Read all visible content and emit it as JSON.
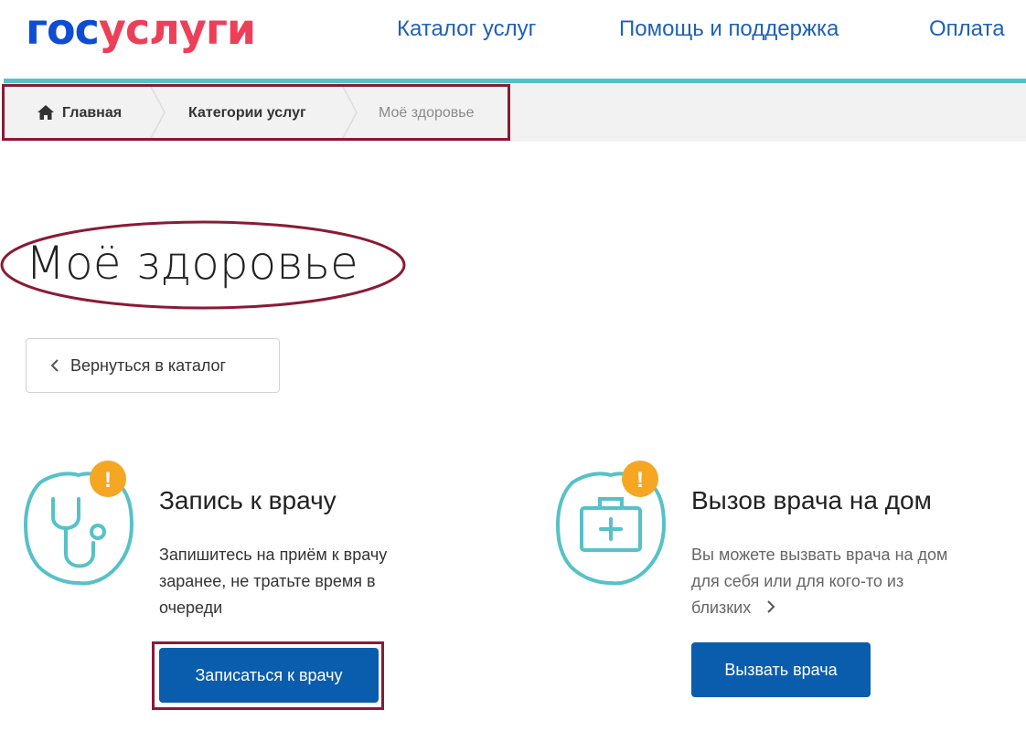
{
  "header": {
    "logo": {
      "part1": "гос",
      "part2": "услуги"
    },
    "nav": [
      "Каталог услуг",
      "Помощь и поддержка",
      "Оплата"
    ]
  },
  "breadcrumb": {
    "home": "Главная",
    "categories": "Категории услуг",
    "current": "Моё здоровье"
  },
  "page": {
    "title": "Моё здоровье",
    "back_button": "Вернуться в каталог"
  },
  "cards": [
    {
      "title": "Запись к врачу",
      "text_lines": [
        "Запишитесь на приём к врачу",
        "заранее, не тратьте время в",
        "очереди"
      ],
      "button": "Записаться к врачу",
      "icon": "stethoscope-icon"
    },
    {
      "title": "Вызов врача на дом",
      "text_lines": [
        "Вы можете вызвать врача на дом",
        "для себя или для кого-то из",
        "близких"
      ],
      "button": "Вызвать врача",
      "icon": "medical-kit-icon"
    }
  ],
  "colors": {
    "logo_blue": "#0d4cd3",
    "logo_red": "#ee3f58",
    "link_blue": "#2060b8",
    "teal": "#56c1c8",
    "badge_orange": "#f5a623",
    "button_blue": "#0a5cad",
    "annotation": "#8a1a35"
  }
}
